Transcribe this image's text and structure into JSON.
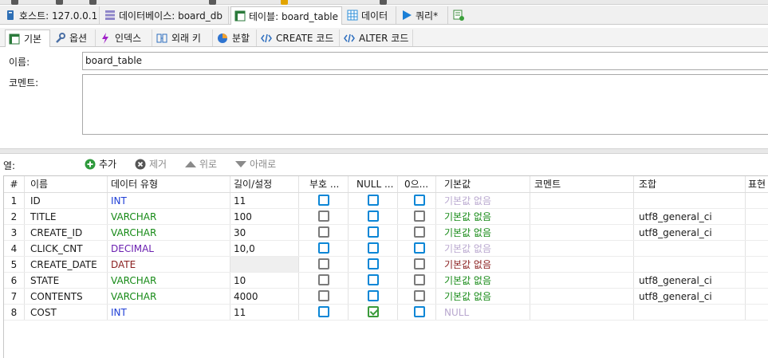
{
  "window_tabs": [
    {
      "label": "호스트: 127.0.0.1",
      "icon": "host-icon"
    },
    {
      "label": "데이터베이스: board_db",
      "icon": "database-icon"
    },
    {
      "label": "테이블: board_table",
      "icon": "table-icon",
      "active": true
    },
    {
      "label": "데이터",
      "icon": "data-grid-icon"
    },
    {
      "label": "쿼리*",
      "icon": "play-icon"
    },
    {
      "label": "",
      "icon": "new-query-icon"
    }
  ],
  "editor_tabs": [
    {
      "label": "기본",
      "icon": "table-basic-icon",
      "active": true
    },
    {
      "label": "옵션",
      "icon": "wrench-icon"
    },
    {
      "label": "인덱스",
      "icon": "lightning-icon"
    },
    {
      "label": "외래 키",
      "icon": "foreign-key-icon"
    },
    {
      "label": "분할",
      "icon": "pie-icon"
    },
    {
      "label": "CREATE 코드",
      "icon": "code-icon"
    },
    {
      "label": "ALTER 코드",
      "icon": "code-icon"
    }
  ],
  "form": {
    "name_label": "이름:",
    "name_value": "board_table",
    "comment_label": "코멘트:",
    "comment_value": ""
  },
  "columns_toolbar": {
    "label": "열:",
    "add": "추가",
    "remove": "제거",
    "up": "위로",
    "down": "아래로"
  },
  "grid": {
    "headers": [
      "#",
      "이름",
      "데이터 유형",
      "길이/설정",
      "부호 ...",
      "NULL ...",
      "0으...",
      "기본값",
      "코멘트",
      "조합",
      "표현"
    ],
    "rows": [
      {
        "num": "1",
        "name": "ID",
        "type": "INT",
        "type_color": "#1f3fd6",
        "length": "11",
        "unsigned": false,
        "unsigned_enabled": true,
        "null": false,
        "zero": false,
        "zero_enabled": true,
        "default": "기본값 없음",
        "default_color": "#b9a8cf",
        "comment": "",
        "collation": ""
      },
      {
        "num": "2",
        "name": "TITLE",
        "type": "VARCHAR",
        "type_color": "#168a16",
        "length": "100",
        "unsigned": false,
        "unsigned_enabled": false,
        "null": false,
        "zero": false,
        "zero_enabled": false,
        "default": "기본값 없음",
        "default_color": "#168a16",
        "comment": "",
        "collation": "utf8_general_ci"
      },
      {
        "num": "3",
        "name": "CREATE_ID",
        "type": "VARCHAR",
        "type_color": "#168a16",
        "length": "30",
        "unsigned": false,
        "unsigned_enabled": false,
        "null": false,
        "zero": false,
        "zero_enabled": false,
        "default": "기본값 없음",
        "default_color": "#168a16",
        "comment": "",
        "collation": "utf8_general_ci"
      },
      {
        "num": "4",
        "name": "CLICK_CNT",
        "type": "DECIMAL",
        "type_color": "#6a1fb0",
        "length": "10,0",
        "unsigned": false,
        "unsigned_enabled": true,
        "null": false,
        "zero": false,
        "zero_enabled": true,
        "default": "기본값 없음",
        "default_color": "#b9a8cf",
        "comment": "",
        "collation": ""
      },
      {
        "num": "5",
        "name": "CREATE_DATE",
        "type": "DATE",
        "type_color": "#8a1f1f",
        "length": "",
        "unsigned": false,
        "unsigned_enabled": false,
        "null": false,
        "zero": false,
        "zero_enabled": false,
        "default": "기본값 없음",
        "default_color": "#8a1f1f",
        "comment": "",
        "collation": ""
      },
      {
        "num": "6",
        "name": "STATE",
        "type": "VARCHAR",
        "type_color": "#168a16",
        "length": "10",
        "unsigned": false,
        "unsigned_enabled": false,
        "null": false,
        "zero": false,
        "zero_enabled": false,
        "default": "기본값 없음",
        "default_color": "#168a16",
        "comment": "",
        "collation": "utf8_general_ci"
      },
      {
        "num": "7",
        "name": "CONTENTS",
        "type": "VARCHAR",
        "type_color": "#168a16",
        "length": "4000",
        "unsigned": false,
        "unsigned_enabled": false,
        "null": false,
        "zero": false,
        "zero_enabled": false,
        "default": "기본값 없음",
        "default_color": "#168a16",
        "comment": "",
        "collation": "utf8_general_ci"
      },
      {
        "num": "8",
        "name": "COST",
        "type": "INT",
        "type_color": "#1f3fd6",
        "length": "11",
        "unsigned": false,
        "unsigned_enabled": true,
        "null": true,
        "zero": false,
        "zero_enabled": true,
        "default": "NULL",
        "default_color": "#b9a8cf",
        "comment": "",
        "collation": ""
      }
    ]
  }
}
